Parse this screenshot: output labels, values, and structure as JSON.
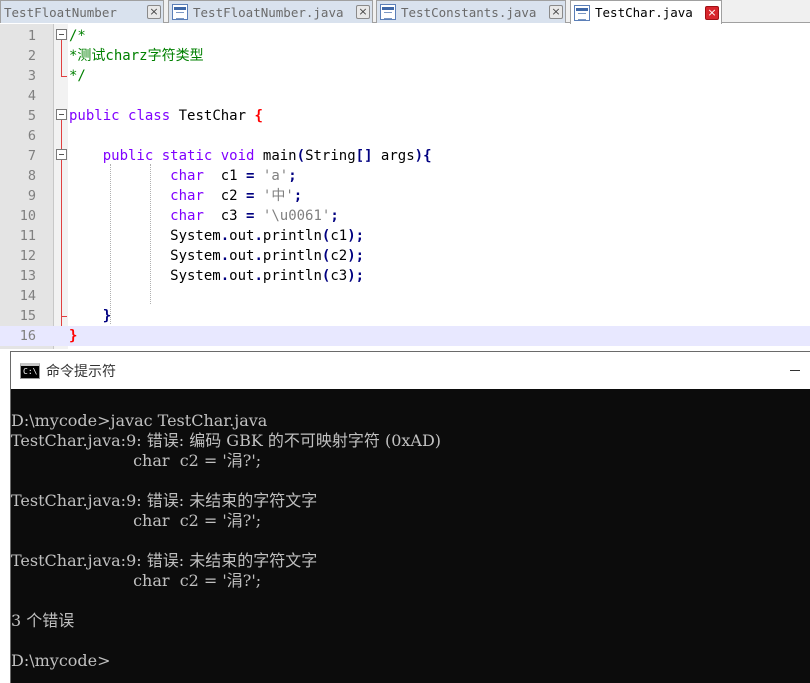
{
  "tabs": [
    {
      "label": "TestFloatNumber",
      "close": "×",
      "active": false
    },
    {
      "label": "TestFloatNumber.java",
      "close": "×",
      "active": false
    },
    {
      "label": "TestConstants.java",
      "close": "×",
      "active": false
    },
    {
      "label": "TestChar.java",
      "close": "×",
      "active": true
    }
  ],
  "editor": {
    "lines": [
      {
        "num": "1",
        "tokens": [
          {
            "t": "/*",
            "c": "comment"
          }
        ]
      },
      {
        "num": "2",
        "tokens": [
          {
            "t": "*测试charz字符类型",
            "c": "comment"
          }
        ]
      },
      {
        "num": "3",
        "tokens": [
          {
            "t": "*/",
            "c": "comment"
          }
        ]
      },
      {
        "num": "4",
        "tokens": []
      },
      {
        "num": "5",
        "tokens": [
          {
            "t": "public",
            "c": "kw"
          },
          {
            "t": " ",
            "c": "plain"
          },
          {
            "t": "class",
            "c": "kw"
          },
          {
            "t": " TestChar ",
            "c": "plain"
          },
          {
            "t": "{",
            "c": "brace"
          }
        ]
      },
      {
        "num": "6",
        "tokens": []
      },
      {
        "num": "7",
        "tokens": [
          {
            "t": "    ",
            "c": "plain"
          },
          {
            "t": "public",
            "c": "kw"
          },
          {
            "t": " ",
            "c": "plain"
          },
          {
            "t": "static",
            "c": "kw"
          },
          {
            "t": " ",
            "c": "plain"
          },
          {
            "t": "void",
            "c": "kw"
          },
          {
            "t": " main",
            "c": "plain"
          },
          {
            "t": "(",
            "c": "op"
          },
          {
            "t": "String",
            "c": "plain"
          },
          {
            "t": "[]",
            "c": "op"
          },
          {
            "t": " args",
            "c": "plain"
          },
          {
            "t": "){",
            "c": "op"
          }
        ]
      },
      {
        "num": "8",
        "tokens": [
          {
            "t": "            ",
            "c": "plain"
          },
          {
            "t": "char",
            "c": "type"
          },
          {
            "t": "  c1 ",
            "c": "plain"
          },
          {
            "t": "=",
            "c": "op"
          },
          {
            "t": " ",
            "c": "plain"
          },
          {
            "t": "'a'",
            "c": "str"
          },
          {
            "t": ";",
            "c": "op"
          }
        ]
      },
      {
        "num": "9",
        "tokens": [
          {
            "t": "            ",
            "c": "plain"
          },
          {
            "t": "char",
            "c": "type"
          },
          {
            "t": "  c2 ",
            "c": "plain"
          },
          {
            "t": "=",
            "c": "op"
          },
          {
            "t": " ",
            "c": "plain"
          },
          {
            "t": "'中'",
            "c": "str"
          },
          {
            "t": ";",
            "c": "op"
          }
        ]
      },
      {
        "num": "10",
        "tokens": [
          {
            "t": "            ",
            "c": "plain"
          },
          {
            "t": "char",
            "c": "type"
          },
          {
            "t": "  c3 ",
            "c": "plain"
          },
          {
            "t": "=",
            "c": "op"
          },
          {
            "t": " ",
            "c": "plain"
          },
          {
            "t": "'\\u0061'",
            "c": "str"
          },
          {
            "t": ";",
            "c": "op"
          }
        ]
      },
      {
        "num": "11",
        "tokens": [
          {
            "t": "            System",
            "c": "plain"
          },
          {
            "t": ".",
            "c": "op"
          },
          {
            "t": "out",
            "c": "plain"
          },
          {
            "t": ".",
            "c": "op"
          },
          {
            "t": "println",
            "c": "plain"
          },
          {
            "t": "(",
            "c": "op"
          },
          {
            "t": "c1",
            "c": "plain"
          },
          {
            "t": ");",
            "c": "op"
          }
        ]
      },
      {
        "num": "12",
        "tokens": [
          {
            "t": "            System",
            "c": "plain"
          },
          {
            "t": ".",
            "c": "op"
          },
          {
            "t": "out",
            "c": "plain"
          },
          {
            "t": ".",
            "c": "op"
          },
          {
            "t": "println",
            "c": "plain"
          },
          {
            "t": "(",
            "c": "op"
          },
          {
            "t": "c2",
            "c": "plain"
          },
          {
            "t": ");",
            "c": "op"
          }
        ]
      },
      {
        "num": "13",
        "tokens": [
          {
            "t": "            System",
            "c": "plain"
          },
          {
            "t": ".",
            "c": "op"
          },
          {
            "t": "out",
            "c": "plain"
          },
          {
            "t": ".",
            "c": "op"
          },
          {
            "t": "println",
            "c": "plain"
          },
          {
            "t": "(",
            "c": "op"
          },
          {
            "t": "c3",
            "c": "plain"
          },
          {
            "t": ");",
            "c": "op"
          }
        ]
      },
      {
        "num": "14",
        "tokens": []
      },
      {
        "num": "15",
        "tokens": [
          {
            "t": "    ",
            "c": "plain"
          },
          {
            "t": "}",
            "c": "op"
          }
        ]
      },
      {
        "num": "16",
        "tokens": [
          {
            "t": "}",
            "c": "brace"
          }
        ],
        "current": true
      }
    ]
  },
  "console": {
    "title": "命令提示符",
    "icon_label": "C:\\",
    "lines": [
      "",
      "D:\\mycode>javac TestChar.java",
      "TestChar.java:9: 错误: 编码 GBK 的不可映射字符 (0xAD)",
      "                        char  c2 = '涓?';",
      "",
      "TestChar.java:9: 错误: 未结束的字符文字",
      "                        char  c2 = '涓?';",
      "",
      "TestChar.java:9: 错误: 未结束的字符文字",
      "                        char  c2 = '涓?';",
      "",
      "3 个错误",
      "",
      "D:\\mycode>"
    ]
  },
  "colors": {
    "comment": "#008000",
    "keyword": "#8000ff",
    "operator": "#000080",
    "string": "#808080",
    "brace": "#ff0000",
    "console_bg": "#0c0c0c",
    "console_fg": "#c0c0c0"
  },
  "icons": {
    "tab_file": "file-icon",
    "tab_close": "close-icon",
    "cmd": "cmd-icon",
    "minimize": "minimize-icon"
  }
}
